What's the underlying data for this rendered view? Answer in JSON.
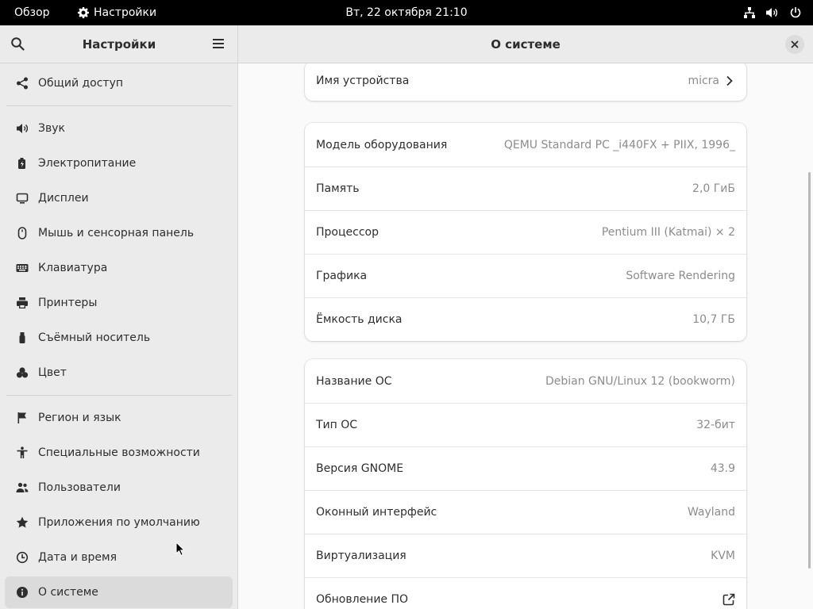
{
  "topbar": {
    "overview": "Обзор",
    "app_name": "Настройки",
    "clock": "Вт, 22 октября  21:10"
  },
  "sidebar": {
    "title": "Настройки",
    "items": [
      {
        "label": "Общий доступ",
        "icon": "share-icon"
      },
      {
        "label": "Звук",
        "icon": "speaker-icon"
      },
      {
        "label": "Электропитание",
        "icon": "battery-icon"
      },
      {
        "label": "Дисплеи",
        "icon": "display-icon"
      },
      {
        "label": "Мышь и сенсорная панель",
        "icon": "mouse-icon"
      },
      {
        "label": "Клавиатура",
        "icon": "keyboard-icon"
      },
      {
        "label": "Принтеры",
        "icon": "printer-icon"
      },
      {
        "label": "Съёмный носитель",
        "icon": "usb-icon"
      },
      {
        "label": "Цвет",
        "icon": "color-icon"
      },
      {
        "label": "Регион и язык",
        "icon": "flag-icon"
      },
      {
        "label": "Специальные возможности",
        "icon": "accessibility-icon"
      },
      {
        "label": "Пользователи",
        "icon": "users-icon"
      },
      {
        "label": "Приложения по умолчанию",
        "icon": "star-icon"
      },
      {
        "label": "Дата и время",
        "icon": "clock-icon"
      },
      {
        "label": "О системе",
        "icon": "info-icon"
      }
    ],
    "active_index": 14
  },
  "main": {
    "title": "О системе",
    "device": {
      "label": "Имя устройства",
      "value": "micra"
    },
    "hardware": [
      {
        "label": "Модель оборудования",
        "value": "QEMU Standard PC _i440FX + PIIX, 1996_"
      },
      {
        "label": "Память",
        "value": "2,0 ГиБ"
      },
      {
        "label": "Процессор",
        "value": "Pentium III (Katmai) × 2"
      },
      {
        "label": "Графика",
        "value": "Software Rendering"
      },
      {
        "label": "Ёмкость диска",
        "value": "10,7 ГБ"
      }
    ],
    "os": [
      {
        "label": "Название ОС",
        "value": "Debian GNU/Linux 12 (bookworm)"
      },
      {
        "label": "Тип ОС",
        "value": "32-бит"
      },
      {
        "label": "Версия GNOME",
        "value": "43.9"
      },
      {
        "label": "Оконный интерфейс",
        "value": "Wayland"
      },
      {
        "label": "Виртуализация",
        "value": "KVM"
      },
      {
        "label": "Обновление ПО",
        "value": ""
      }
    ]
  },
  "colors": {
    "topbar_bg": "#000000",
    "sidebar_bg": "#ebebeb",
    "active_item_bg": "#dbdbdb",
    "card_bg": "#ffffff",
    "value_text": "#8c8c8c"
  }
}
